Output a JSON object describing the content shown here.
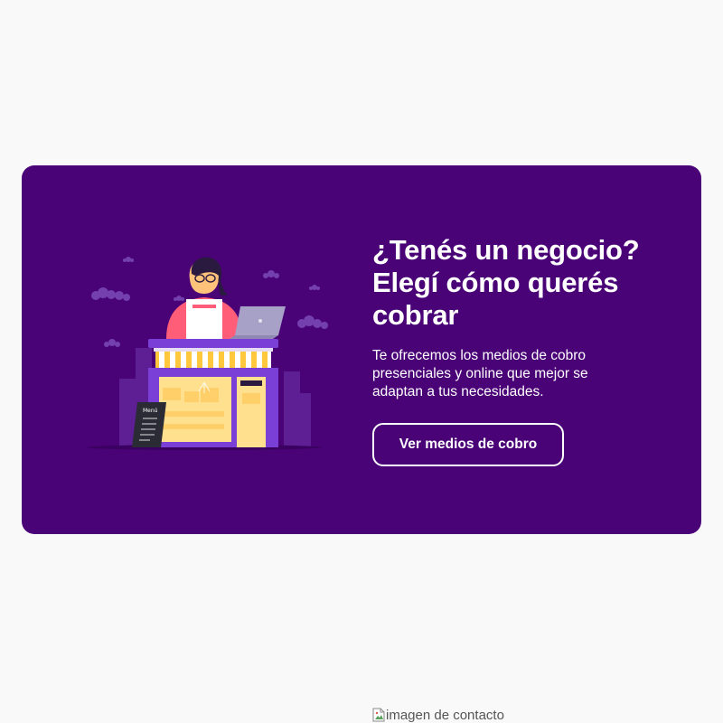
{
  "promo": {
    "title": "¿Tenés un negocio? Elegí cómo querés cobrar",
    "description": "Te ofrecemos los medios de cobro presenciales y online que mejor se adaptan a tus necesidades.",
    "button_label": "Ver medios de cobro",
    "illustration_icon": "shopkeeper-storefront-illustration",
    "menu_board_text": "Menú"
  },
  "contact": {
    "image_alt": "imagen de contacto",
    "icon": "broken-image-icon"
  },
  "colors": {
    "page_background": "#f9f9f9",
    "card_background": "#4a0277",
    "text_on_card": "#ffffff",
    "awning_yellow": "#ffc83d",
    "shop_purple": "#7a3fd6"
  }
}
